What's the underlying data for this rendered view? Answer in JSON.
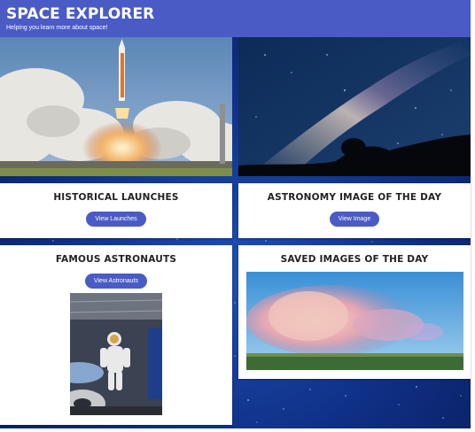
{
  "header": {
    "title": "SPACE EXPLORER",
    "subtitle": "Helping you learn more about space!"
  },
  "colors": {
    "accent": "#4a5bc6",
    "space_background": "#1a3f9c",
    "card_background": "#ffffff"
  },
  "hero_images": [
    {
      "icon": "shuttle-launch-photo"
    },
    {
      "icon": "milky-way-photo"
    }
  ],
  "cards": {
    "historical": {
      "title": "HISTORICAL LAUNCHES",
      "button": "View Launches"
    },
    "apod": {
      "title": "ASTRONOMY IMAGE OF THE DAY",
      "button": "View Image"
    },
    "astronauts": {
      "title": "FAMOUS ASTRONAUTS",
      "button": "View Astronauts",
      "image": "astronaut-training-photo"
    },
    "saved": {
      "title": "SAVED IMAGES OF THE DAY",
      "image": "storm-cloud-photo"
    }
  }
}
